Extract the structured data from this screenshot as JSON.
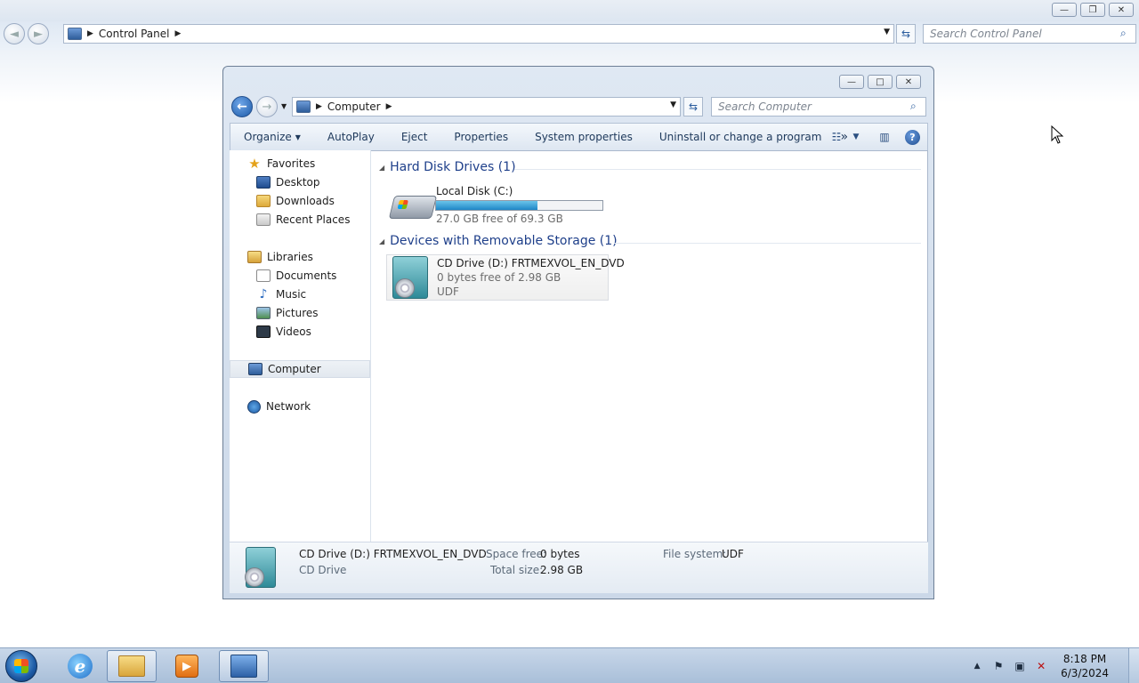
{
  "background_window": {
    "breadcrumb": [
      "Control Panel"
    ],
    "search_placeholder": "Search Control Panel",
    "buttons": {
      "minimize": "—",
      "restore": "❐",
      "close": "✕"
    }
  },
  "window": {
    "breadcrumb": [
      "Computer"
    ],
    "search_placeholder": "Search Computer",
    "buttons": {
      "minimize": "—",
      "maximize": "□",
      "close": "✕"
    },
    "toolbar": {
      "organize": "Organize",
      "autoplay": "AutoPlay",
      "eject": "Eject",
      "properties": "Properties",
      "system_properties": "System properties",
      "uninstall": "Uninstall or change a program",
      "more": "»"
    },
    "nav": {
      "favorites": "Favorites",
      "desktop": "Desktop",
      "downloads": "Downloads",
      "recent_places": "Recent Places",
      "libraries": "Libraries",
      "documents": "Documents",
      "music": "Music",
      "pictures": "Pictures",
      "videos": "Videos",
      "computer": "Computer",
      "network": "Network"
    },
    "groups": {
      "hard_disk": {
        "header": "Hard Disk Drives (1)",
        "drives": [
          {
            "name": "Local Disk (C:)",
            "free": "27.0 GB free of 69.3 GB",
            "used_fraction": 0.61
          }
        ]
      },
      "removable": {
        "header": "Devices with Removable Storage (1)",
        "drives": [
          {
            "name": "CD Drive (D:) FRTMEXVOL_EN_DVD",
            "free": "0 bytes free of 2.98 GB",
            "filesystem": "UDF"
          }
        ]
      }
    },
    "details": {
      "name": "CD Drive (D:) FRTMEXVOL_EN_DVD",
      "type": "CD Drive",
      "space_free_label": "Space free:",
      "space_free": "0 bytes",
      "total_size_label": "Total size:",
      "total_size": "2.98 GB",
      "file_system_label": "File system:",
      "file_system": "UDF"
    }
  },
  "taskbar": {
    "clock_time": "8:18 PM",
    "clock_date": "6/3/2024"
  }
}
